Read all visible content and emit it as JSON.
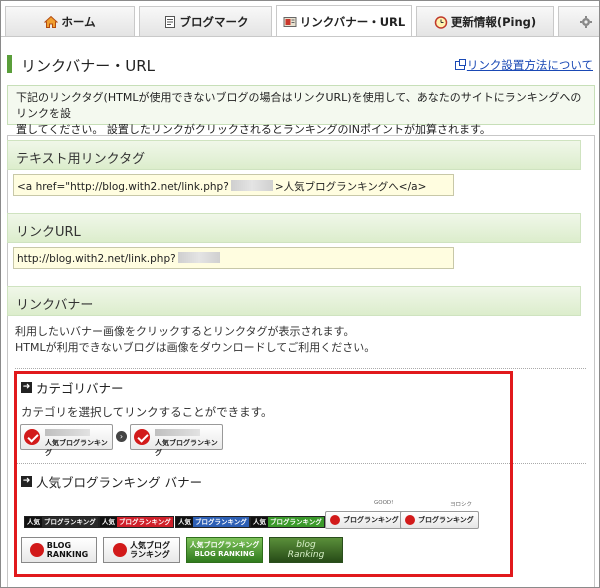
{
  "tabs": [
    {
      "label": "ホーム",
      "icon": "home-icon"
    },
    {
      "label": "ブログマーク",
      "icon": "document-icon"
    },
    {
      "label": "リンクバナー・URL",
      "icon": "banner-icon",
      "active": true
    },
    {
      "label": "更新情報(Ping)",
      "icon": "clock-icon"
    },
    {
      "label": "",
      "icon": "gear-icon"
    }
  ],
  "page": {
    "title": "リンクバナー・URL",
    "help_link": "リンク設置方法について",
    "intro_line1": "下記のリンクタグ(HTMLが使用できないブログの場合はリンクURL)を使用して、あなたのサイトにランキングへのリンクを設",
    "intro_line2": "置してください。 設置したリンクがクリックされるとランキングのINポイントが加算されます。"
  },
  "sections": {
    "text_link": {
      "heading": "テキスト用リンクタグ",
      "value_before": "<a href=\"http://blog.with2.net/link.php?",
      "value_after": ">人気ブログランキングへ</a>"
    },
    "link_url": {
      "heading": "リンクURL",
      "value": "http://blog.with2.net/link.php?"
    },
    "link_banner": {
      "heading": "リンクバナー",
      "help_line1": "利用したいバナー画像をクリックするとリンクタグが表示されます。",
      "help_line2": "HTMLが利用できないブログは画像をダウンロードしてご利用ください。"
    }
  },
  "category_banner": {
    "heading": "カテゴリバナー",
    "description": "カテゴリを選択してリンクすることができます。",
    "banner_label": "人気ブログランキング"
  },
  "popular_banner": {
    "heading": "人気ブログランキング バナー",
    "small": [
      {
        "k": "人気",
        "v": "ブログランキング",
        "color": "#2a2a2a"
      },
      {
        "k": "人気",
        "v": "ブログランキング",
        "color": "#d0202a"
      },
      {
        "k": "人気",
        "v": "ブログランキング",
        "color": "#2c5fb5"
      },
      {
        "k": "人気",
        "v": "ブログランキング",
        "color": "#3a9a2a"
      }
    ],
    "white1": "ブログランキング",
    "white2": "ブログランキング",
    "cap1": "GOOD!",
    "cap2": "ヨロシク",
    "big1_l1": "BLOG",
    "big1_l2": "RANKING",
    "big2_l1": "人気ブログ",
    "big2_l2": "ランキング",
    "big3_l1": "人気ブログランキング",
    "big3_l2": "BLOG RANKING",
    "big4_l1": "blog",
    "big4_l2": "Ranking"
  }
}
